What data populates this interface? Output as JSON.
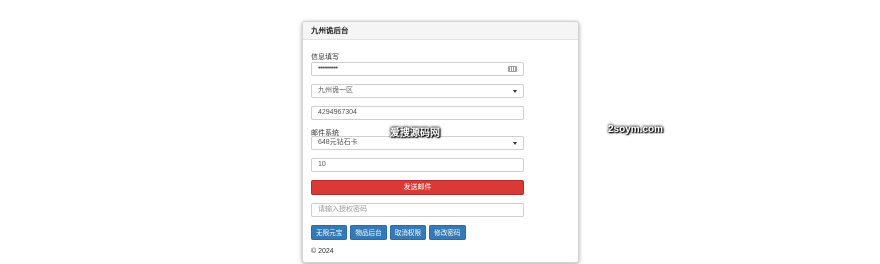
{
  "panel": {
    "title": "九州诡后台",
    "section_info_label": "信息填写",
    "password_value": "••••••••••",
    "server_select": "九州诡一区",
    "account_id": "4294967304",
    "section_mail_label": "邮件系统",
    "item_select": "648元钻石卡",
    "quantity": "10",
    "send_button": "发送邮件",
    "auth_placeholder": "请输入授权密码",
    "buttons": [
      "无限元宝",
      "物品后台",
      "取消权限",
      "修改密码"
    ],
    "footer": "© 2024"
  },
  "watermarks": {
    "center": "爱搜源码网",
    "right": "2soym.com"
  },
  "colors": {
    "send_button": "#d93a36",
    "action_buttons": "#337ab7"
  }
}
